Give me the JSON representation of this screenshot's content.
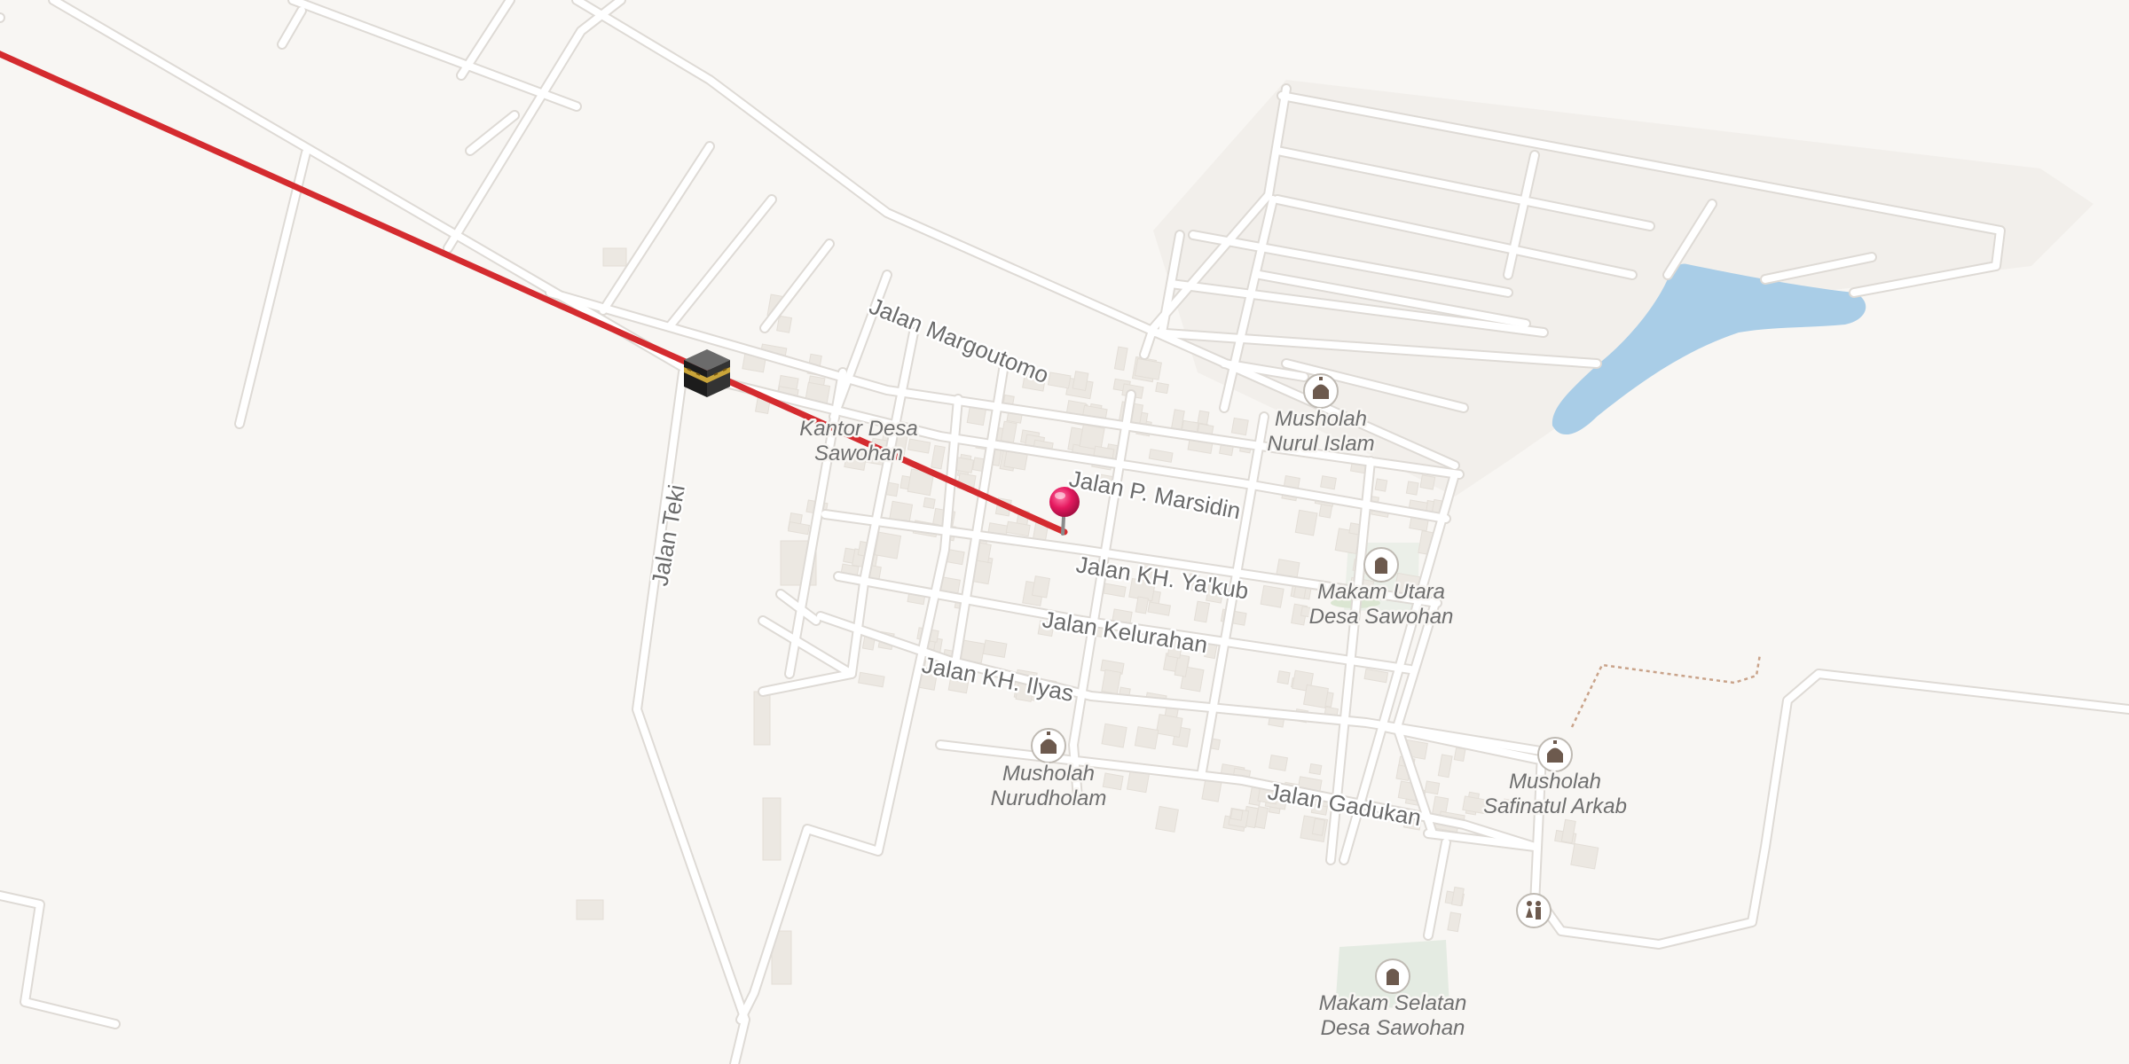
{
  "colors": {
    "background": "#f8f6f3",
    "road_fill": "#ffffff",
    "road_casing": "#dedad5",
    "building": "#ece8e2",
    "water": "#a9cde7",
    "park": "#e4ebe2",
    "qibla_line": "#d42b2f",
    "pin": "#e5195f",
    "footpath": "#c9a38a"
  },
  "qibla": {
    "target_icon": "kaaba-icon"
  },
  "pin": {
    "icon": "location-pin-icon"
  },
  "streets": [
    {
      "id": "jalan-margoutomo",
      "label": "Jalan Margoutomo"
    },
    {
      "id": "jalan-p-marsidin",
      "label": "Jalan P. Marsidin"
    },
    {
      "id": "jalan-kh-yakub",
      "label": "Jalan KH. Ya'kub"
    },
    {
      "id": "jalan-kelurahan",
      "label": "Jalan Kelurahan"
    },
    {
      "id": "jalan-kh-ilyas",
      "label": "Jalan KH. Ilyas"
    },
    {
      "id": "jalan-gadukan",
      "label": "Jalan Gadukan"
    },
    {
      "id": "jalan-teki",
      "label": "Jalan Teki"
    }
  ],
  "pois": [
    {
      "id": "musholah-nurul-islam",
      "icon": "mosque-icon",
      "line1": "Musholah",
      "line2": "Nurul Islam"
    },
    {
      "id": "makam-utara",
      "icon": "cemetery-icon",
      "line1": "Makam Utara",
      "line2": "Desa Sawohan"
    },
    {
      "id": "musholah-nurudholam",
      "icon": "mosque-icon",
      "line1": "Musholah",
      "line2": "Nurudholam"
    },
    {
      "id": "musholah-safinatul-arkab",
      "icon": "mosque-icon",
      "line1": "Musholah",
      "line2": "Safinatul Arkab"
    },
    {
      "id": "makam-selatan",
      "icon": "cemetery-icon",
      "line1": "Makam Selatan",
      "line2": "Desa Sawohan"
    },
    {
      "id": "toilets",
      "icon": "toilets-icon",
      "line1": "",
      "line2": ""
    },
    {
      "id": "kantor-desa",
      "icon": "",
      "line1": "Kantor Desa",
      "line2": "Sawohan"
    }
  ]
}
